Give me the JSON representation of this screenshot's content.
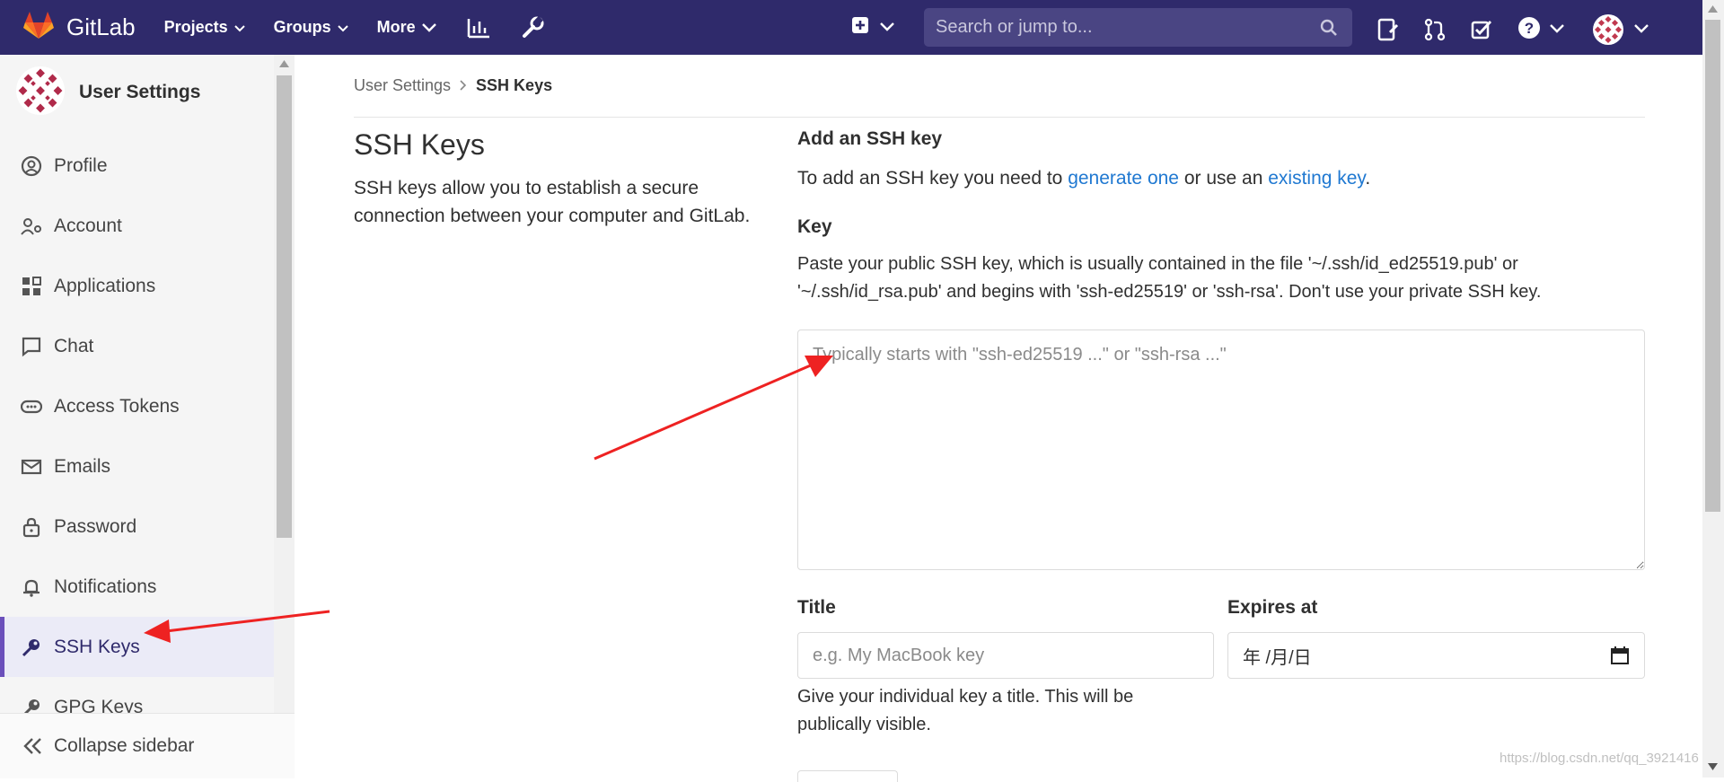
{
  "navbar": {
    "brand": "GitLab",
    "menu": [
      {
        "label": "Projects"
      },
      {
        "label": "Groups"
      },
      {
        "label": "More"
      }
    ],
    "search_placeholder": "Search or jump to..."
  },
  "sidebar": {
    "title": "User Settings",
    "items": [
      {
        "label": "Profile",
        "icon": "profile-icon"
      },
      {
        "label": "Account",
        "icon": "account-icon"
      },
      {
        "label": "Applications",
        "icon": "applications-icon"
      },
      {
        "label": "Chat",
        "icon": "chat-icon"
      },
      {
        "label": "Access Tokens",
        "icon": "token-icon"
      },
      {
        "label": "Emails",
        "icon": "mail-icon"
      },
      {
        "label": "Password",
        "icon": "lock-icon"
      },
      {
        "label": "Notifications",
        "icon": "bell-icon"
      },
      {
        "label": "SSH Keys",
        "icon": "key-icon",
        "active": true
      },
      {
        "label": "GPG Keys",
        "icon": "key-icon"
      }
    ],
    "collapse_label": "Collapse sidebar"
  },
  "breadcrumb": {
    "parent": "User Settings",
    "current": "SSH Keys"
  },
  "section": {
    "title": "SSH Keys",
    "description": "SSH keys allow you to establish a secure connection between your computer and GitLab."
  },
  "form": {
    "heading": "Add an SSH key",
    "intro_prefix": "To add an SSH key you need to ",
    "generate_link": "generate one",
    "intro_middle": " or use an ",
    "existing_link": "existing key",
    "intro_suffix": ".",
    "key_label": "Key",
    "key_help_line1": "Paste your public SSH key, which is usually contained in the file '~/.ssh/id_ed25519.pub' or",
    "key_help_line2": "'~/.ssh/id_rsa.pub' and begins with 'ssh-ed25519' or 'ssh-rsa'. Don't use your private SSH key.",
    "key_placeholder": "Typically starts with \"ssh-ed25519 ...\" or \"ssh-rsa ...\"",
    "title_label": "Title",
    "title_placeholder": "e.g. My MacBook key",
    "title_help_line1": "Give your individual key a title. This will be",
    "title_help_line2": "publically visible.",
    "expires_label": "Expires at",
    "expires_placeholder": "年 /月/日"
  },
  "watermark": "https://blog.csdn.net/qq_3921416",
  "colors": {
    "navbar_bg": "#2f2a6b",
    "link": "#1f78d1",
    "active_border": "#6b4fbb",
    "annotation_arrow": "#ee2222"
  }
}
